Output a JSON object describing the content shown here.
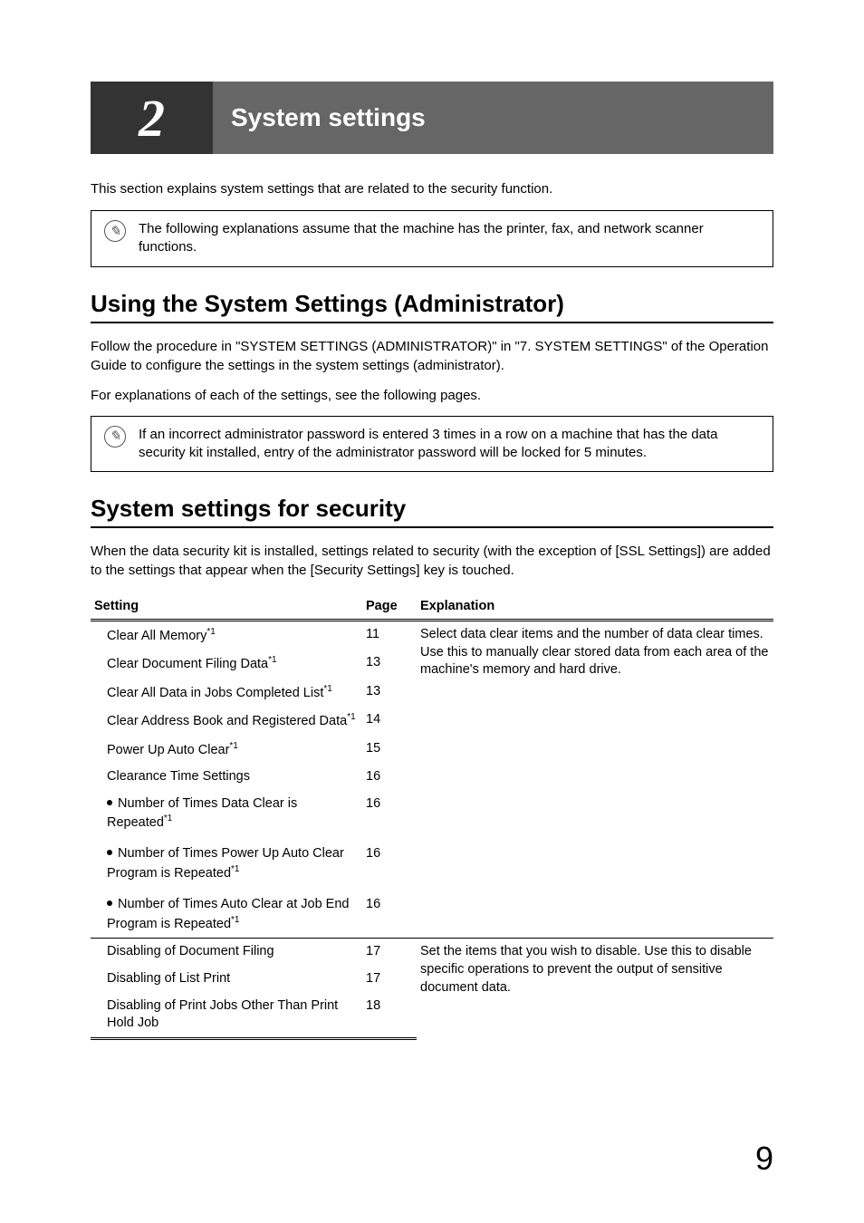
{
  "chapter": {
    "number": "2",
    "title": "System settings"
  },
  "intro": "This section explains system settings that are related to the security function.",
  "note1": "The following explanations assume that the machine has the printer, fax, and network scanner functions.",
  "section1": {
    "title": "Using the System Settings (Administrator)",
    "para1": "Follow the procedure in \"SYSTEM SETTINGS (ADMINISTRATOR)\" in \"7. SYSTEM SETTINGS\" of the Operation Guide to configure the settings in the system settings (administrator).",
    "para2": "For explanations of each of the settings, see the following pages."
  },
  "note2": "If an incorrect administrator password is entered 3 times in a row on a machine that has the data security kit installed, entry of the administrator password will be locked for 5 minutes.",
  "section2": {
    "title": "System settings for security",
    "para": "When the data security kit is installed, settings related to security (with the exception of [SSL Settings]) are added to the settings that appear when the [Security Settings] key is touched."
  },
  "table": {
    "headers": {
      "setting": "Setting",
      "page": "Page",
      "explanation": "Explanation"
    },
    "group1": {
      "explanation": "Select data clear items and the number of data clear times. Use this to manually clear stored data from each area of the machine's memory and hard drive.",
      "rows": [
        {
          "name": "Clear All Memory",
          "sup": "*1",
          "page": "11"
        },
        {
          "name": "Clear Document Filing Data",
          "sup": "*1",
          "page": "13"
        },
        {
          "name": "Clear All Data in Jobs Completed List",
          "sup": "*1",
          "page": "13"
        },
        {
          "name": "Clear Address Book and Registered Data",
          "sup": "*1",
          "page": "14"
        },
        {
          "name": "Power Up Auto Clear",
          "sup": "*1",
          "page": "15"
        },
        {
          "name": "Clearance Time Settings",
          "sup": "",
          "page": "16"
        },
        {
          "name": "Number of Times Data Clear is Repeated",
          "sup": "*1",
          "page": "16",
          "bullet": true
        },
        {
          "name": "Number of Times Power Up Auto Clear Program is Repeated",
          "sup": "*1",
          "page": "16",
          "bullet": true
        },
        {
          "name": "Number of Times Auto Clear at Job End Program is Repeated",
          "sup": "*1",
          "page": "16",
          "bullet": true
        }
      ]
    },
    "group2": {
      "explanation": "Set the items that you wish to disable. Use this to disable specific operations to prevent the output of sensitive document data.",
      "rows": [
        {
          "name": "Disabling of Document Filing",
          "page": "17"
        },
        {
          "name": "Disabling of List Print",
          "page": "17"
        },
        {
          "name": "Disabling of Print Jobs Other Than Print Hold Job",
          "page": "18"
        }
      ]
    }
  },
  "pageNumber": "9"
}
